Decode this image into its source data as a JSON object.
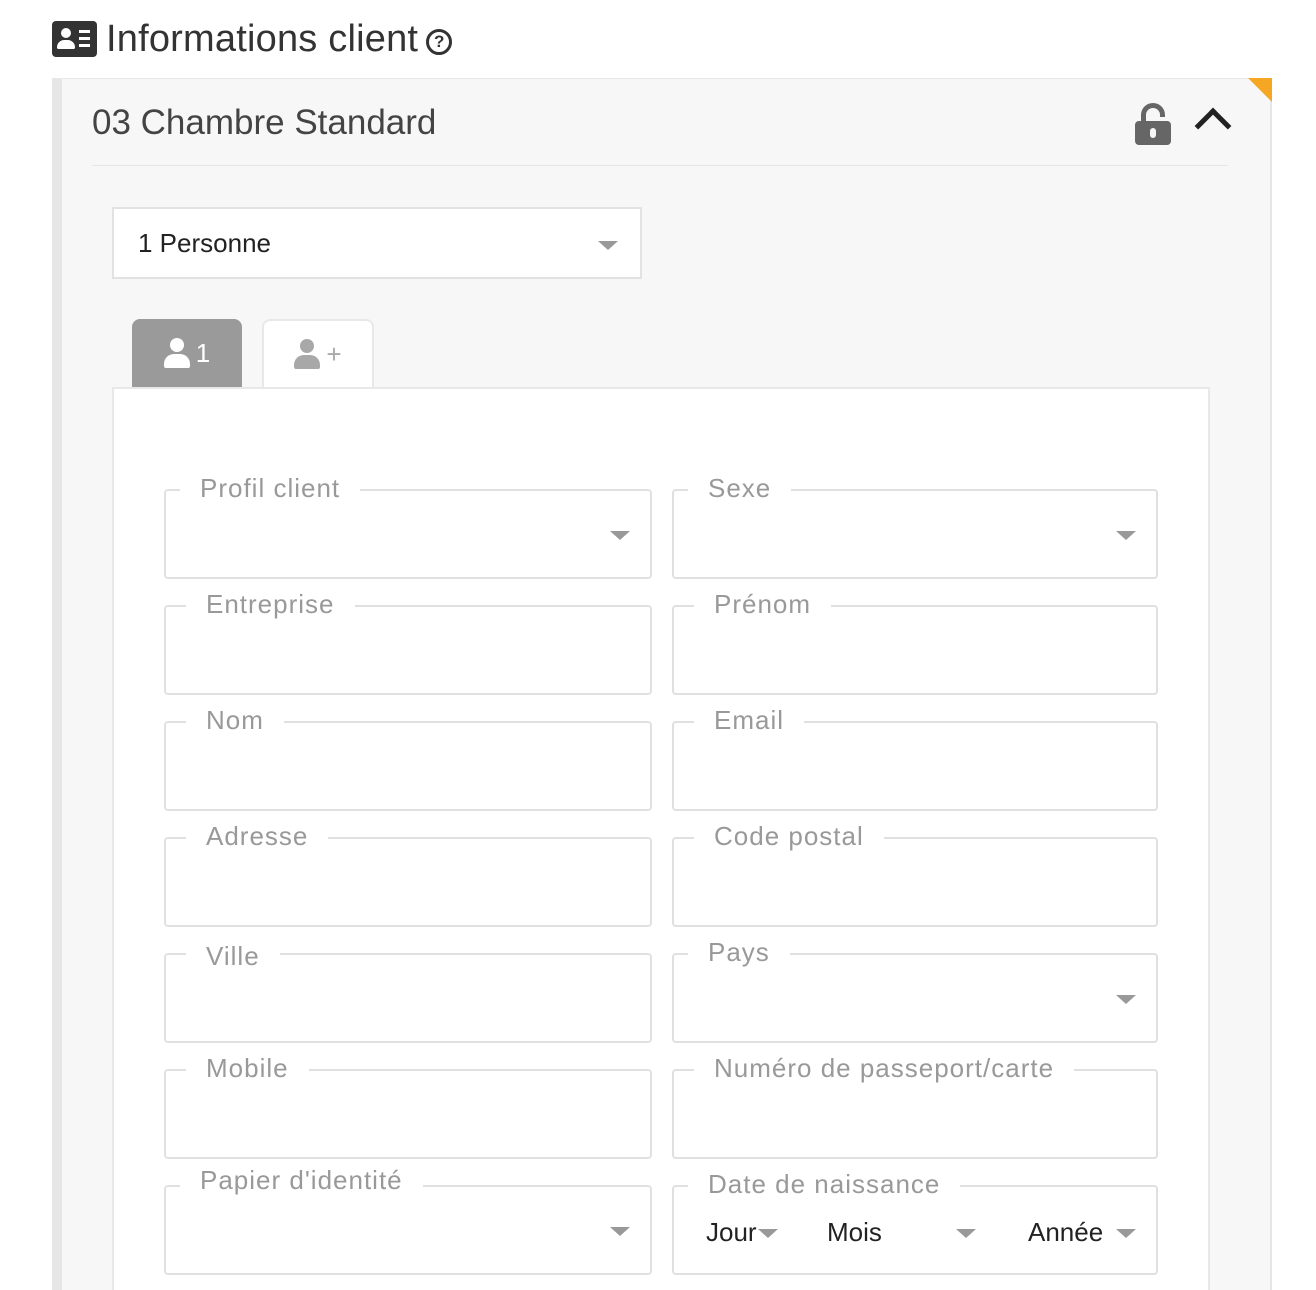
{
  "section": {
    "title": "Informations client",
    "help": "?"
  },
  "room": {
    "title": "03 Chambre Standard"
  },
  "person_select": {
    "value": "1 Personne"
  },
  "tabs": {
    "active_label": "1",
    "add_label": "+"
  },
  "fields": {
    "profil_client": {
      "label": "Profil client",
      "value": ""
    },
    "sexe": {
      "label": "Sexe",
      "value": ""
    },
    "entreprise": {
      "label": "Entreprise",
      "value": ""
    },
    "prenom": {
      "label": "Prénom",
      "value": ""
    },
    "nom": {
      "label": "Nom",
      "value": ""
    },
    "email": {
      "label": "Email",
      "value": ""
    },
    "adresse": {
      "label": "Adresse",
      "value": ""
    },
    "code_postal": {
      "label": "Code postal",
      "value": ""
    },
    "ville": {
      "label": "Ville",
      "value": ""
    },
    "pays": {
      "label": "Pays",
      "value": ""
    },
    "mobile": {
      "label": "Mobile",
      "value": ""
    },
    "passeport": {
      "label": "Numéro de passeport/carte",
      "value": ""
    },
    "papier_identite": {
      "label": "Papier d'identité",
      "value": ""
    },
    "date_naissance": {
      "label": "Date de naissance",
      "jour": "Jour",
      "mois": "Mois",
      "annee": "Année"
    }
  },
  "colors": {
    "accent_corner": "#f5a623",
    "active_tab": "#9a9a9a"
  },
  "icons": [
    "id-card-icon",
    "help-icon",
    "unlock-icon",
    "chevron-up-icon",
    "user-icon",
    "caret-down-icon"
  ]
}
